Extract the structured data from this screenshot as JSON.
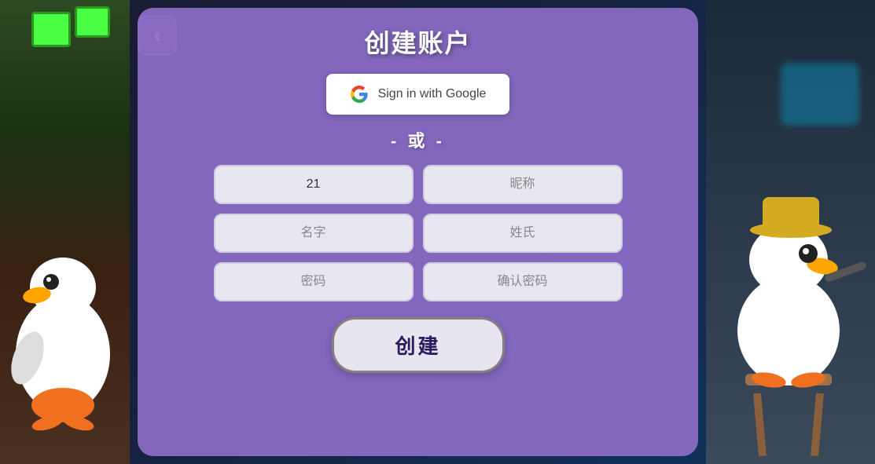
{
  "dialog": {
    "title": "创建账户",
    "or_divider": "- 或 -",
    "google_btn_label": "Sign in with Google",
    "fields": [
      {
        "placeholder": "21",
        "name": "username-field",
        "value": "21"
      },
      {
        "placeholder": "昵称",
        "name": "nickname-field",
        "value": ""
      },
      {
        "placeholder": "名字",
        "name": "firstname-field",
        "value": ""
      },
      {
        "placeholder": "姓氏",
        "name": "lastname-field",
        "value": ""
      },
      {
        "placeholder": "密码",
        "name": "password-field",
        "value": ""
      },
      {
        "placeholder": "确认密码",
        "name": "confirm-password-field",
        "value": ""
      }
    ],
    "create_btn_label": "创建"
  },
  "back_btn": {
    "label": "‹"
  }
}
